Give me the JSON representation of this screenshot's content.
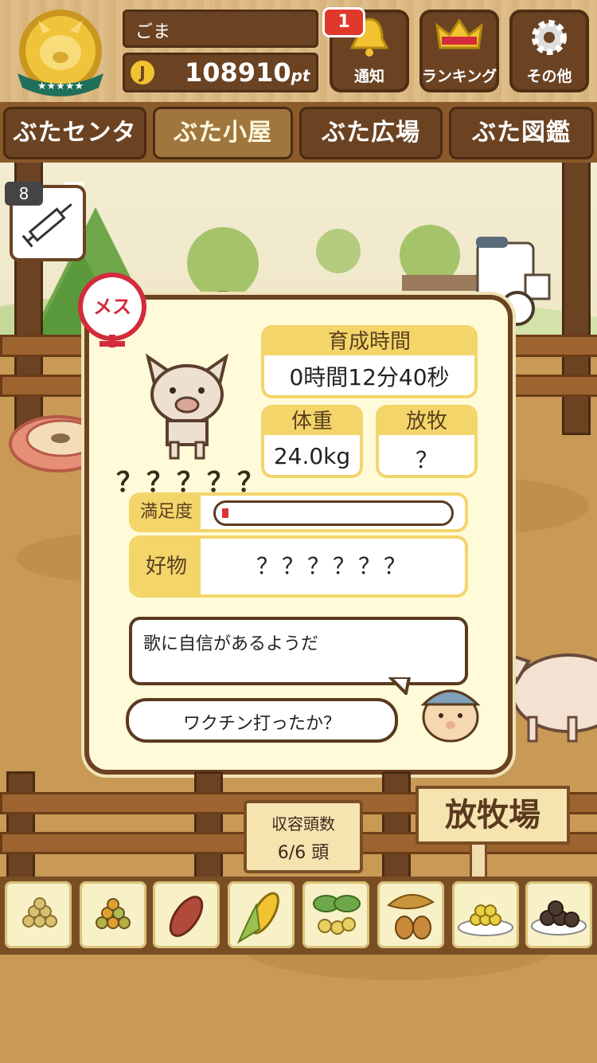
{
  "header": {
    "username": "ごま",
    "coin_symbol": "J",
    "points": "108910",
    "points_unit": "pt",
    "notification_count": "1",
    "buttons": [
      {
        "label": "通知",
        "icon": "bell-icon"
      },
      {
        "label": "ランキング",
        "icon": "crown-icon"
      },
      {
        "label": "その他",
        "icon": "gear-icon"
      }
    ]
  },
  "nav": {
    "tabs": [
      "ぶたセンター",
      "ぶた小屋",
      "ぶた広場",
      "ぶた図鑑"
    ],
    "active_tab": "ぶた小屋"
  },
  "vaccine": {
    "count": "8",
    "icon": "syringe-icon"
  },
  "pig_panel": {
    "gender": "メス",
    "name": "？？？？？",
    "growth_time_label": "育成時間",
    "growth_time_value": "0時間12分40秒",
    "weight_label": "体重",
    "weight_value": "24.0kg",
    "grazing_label": "放牧",
    "grazing_value": "？",
    "satisfaction_label": "満足度",
    "satisfaction_level": 0.03,
    "favorite_label": "好物",
    "favorite_value": "？？？？？？",
    "comment": "歌に自信があるようだ",
    "farmer_question": "ワクチン打ったか？"
  },
  "capacity": {
    "label": "収容頭数",
    "value": "6/6 頭"
  },
  "ranch_sign": "放牧場",
  "food_items": [
    "soybeans-icon",
    "mixed-beans-icon",
    "sweet-potato-icon",
    "corn-icon",
    "nuts-leaves-icon",
    "acorn-icon",
    "grain-plate-icon",
    "dark-balls-plate-icon"
  ],
  "colors": {
    "wood_dark": "#6b4323",
    "panel_bg": "#fffbd8",
    "accent_yellow": "#f3d56a",
    "female_red": "#d32b3b",
    "badge_red": "#e0392b"
  }
}
